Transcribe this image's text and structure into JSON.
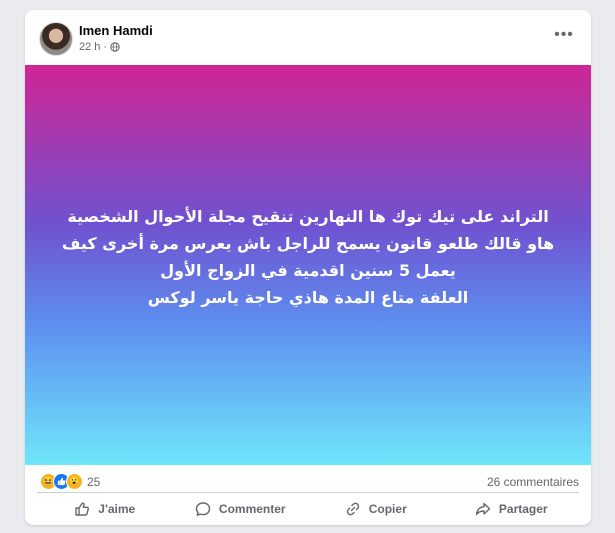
{
  "post": {
    "author": "Imen Hamdi",
    "time": "22 h",
    "privacy_icon": "globe-icon",
    "lines": [
      "التراند على تيك توك ها النهارين تنقيح مجلة الأحوال الشخصية",
      "هاو قالك طلعو قانون يسمح للراجل باش يعرس مرة أخرى كيف",
      "يعمل 5 سنين اقدمية في الزواج الأول",
      "العلفة متاع المدة هاذي حاجة ياسر لوكس"
    ],
    "gradient": [
      "#d02594",
      "#6f52d0",
      "#5d8ff0",
      "#6fe6fa"
    ]
  },
  "reactions": {
    "types": [
      "haha",
      "like",
      "wow"
    ],
    "count": "25",
    "comments": "26 commentaires"
  },
  "actions": {
    "like": "J'aime",
    "comment": "Commenter",
    "copy": "Copier",
    "share": "Partager"
  }
}
